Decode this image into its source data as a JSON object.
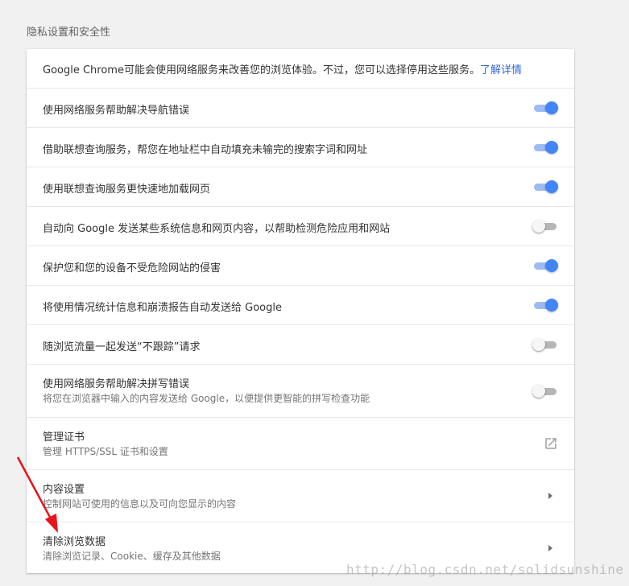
{
  "section": {
    "title": "隐私设置和安全性"
  },
  "intro": {
    "text": "Google Chrome可能会使用网络服务来改善您的浏览体验。不过，您可以选择停用这些服务。",
    "link": "了解详情"
  },
  "toggles": [
    {
      "label": "使用网络服务帮助解决导航错误",
      "on": true
    },
    {
      "label": "借助联想查询服务，帮您在地址栏中自动填充未输完的搜索字词和网址",
      "on": true
    },
    {
      "label": "使用联想查询服务更快速地加载网页",
      "on": true
    },
    {
      "label": "自动向 Google 发送某些系统信息和网页内容，以帮助检测危险应用和网站",
      "on": false
    },
    {
      "label": "保护您和您的设备不受危险网站的侵害",
      "on": true
    },
    {
      "label": "将使用情况统计信息和崩溃报告自动发送给 Google",
      "on": true
    },
    {
      "label": "随浏览流量一起发送“不跟踪”请求",
      "on": false
    },
    {
      "label": "使用网络服务帮助解决拼写错误",
      "sub": "将您在浏览器中输入的内容发送给 Google，以便提供更智能的拼写检查功能",
      "on": false
    }
  ],
  "certificates": {
    "label": "管理证书",
    "sub": "管理 HTTPS/SSL 证书和设置",
    "icon": "open-in-new-icon"
  },
  "content_settings": {
    "label": "内容设置",
    "sub": "控制网站可使用的信息以及可向您显示的内容",
    "icon": "chevron-right-icon"
  },
  "clear_data": {
    "label": "清除浏览数据",
    "sub": "清除浏览记录、Cookie、缓存及其他数据",
    "icon": "chevron-right-icon"
  },
  "watermark": "http://blog.csdn.net/solidsunshine",
  "colors": {
    "toggle_on": "#4285f4",
    "toggle_on_track": "#9dbaf3",
    "link": "#3367d6",
    "arrow": "#e8141c"
  }
}
